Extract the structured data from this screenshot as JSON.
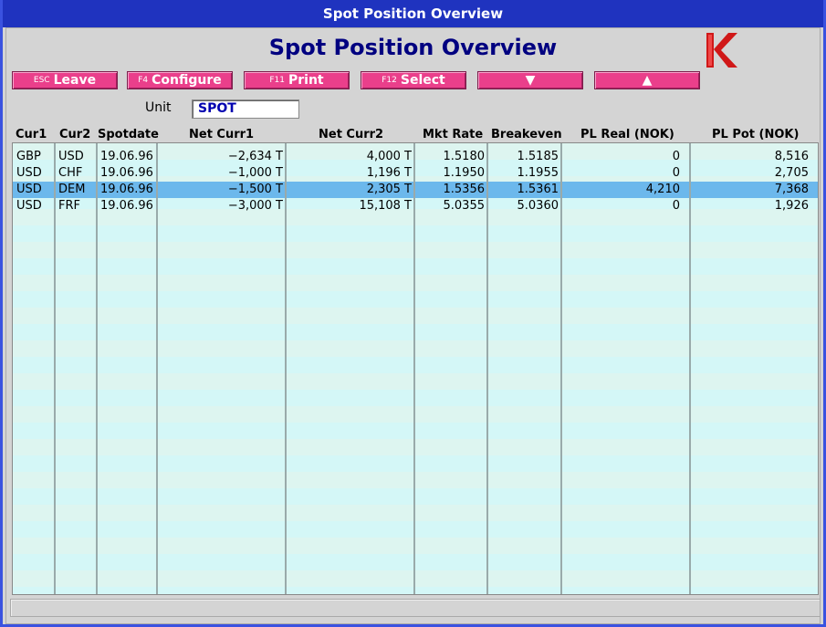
{
  "window": {
    "title": "Spot Position Overview"
  },
  "page": {
    "title": "Spot Position Overview"
  },
  "toolbar": {
    "leave": {
      "key": "ESC",
      "label": "Leave"
    },
    "configure": {
      "key": "F4",
      "label": "Configure"
    },
    "print": {
      "key": "F11",
      "label": "Print"
    },
    "select": {
      "key": "F12",
      "label": "Select"
    },
    "down": {
      "label": "▼"
    },
    "up": {
      "label": "▲"
    }
  },
  "unit": {
    "label": "Unit",
    "value": "SPOT"
  },
  "table": {
    "columns": [
      "Cur1",
      "Cur2",
      "Spotdate",
      "Net Curr1",
      "Net Curr2",
      "Mkt Rate",
      "Breakeven",
      "PL Real (NOK)",
      "PL Pot (NOK)"
    ],
    "rows": [
      {
        "cur1": "GBP",
        "cur2": "USD",
        "spotdate": "19.06.96",
        "net_curr1": "−2,634 T",
        "net_curr2": "4,000 T",
        "mkt_rate": "1.5180",
        "breakeven": "1.5185",
        "pl_real": "0",
        "pl_pot": "8,516"
      },
      {
        "cur1": "USD",
        "cur2": "CHF",
        "spotdate": "19.06.96",
        "net_curr1": "−1,000 T",
        "net_curr2": "1,196 T",
        "mkt_rate": "1.1950",
        "breakeven": "1.1955",
        "pl_real": "0",
        "pl_pot": "2,705"
      },
      {
        "cur1": "USD",
        "cur2": "DEM",
        "spotdate": "19.06.96",
        "net_curr1": "−1,500 T",
        "net_curr2": "2,305 T",
        "mkt_rate": "1.5356",
        "breakeven": "1.5361",
        "pl_real": "4,210",
        "pl_pot": "7,368"
      },
      {
        "cur1": "USD",
        "cur2": "FRF",
        "spotdate": "19.06.96",
        "net_curr1": "−3,000 T",
        "net_curr2": "15,108 T",
        "mkt_rate": "5.0355",
        "breakeven": "5.0360",
        "pl_real": "0",
        "pl_pot": "1,926"
      }
    ],
    "selected_row": 2
  },
  "colors": {
    "titlebar": "#1f33bf",
    "button": "#ea3f8b",
    "selection": "#6cb8ec",
    "row_a": "#ddf5f0",
    "row_b": "#d4f7f7",
    "title_text": "#000080"
  },
  "icons": {
    "logo": "k-logo-icon"
  }
}
